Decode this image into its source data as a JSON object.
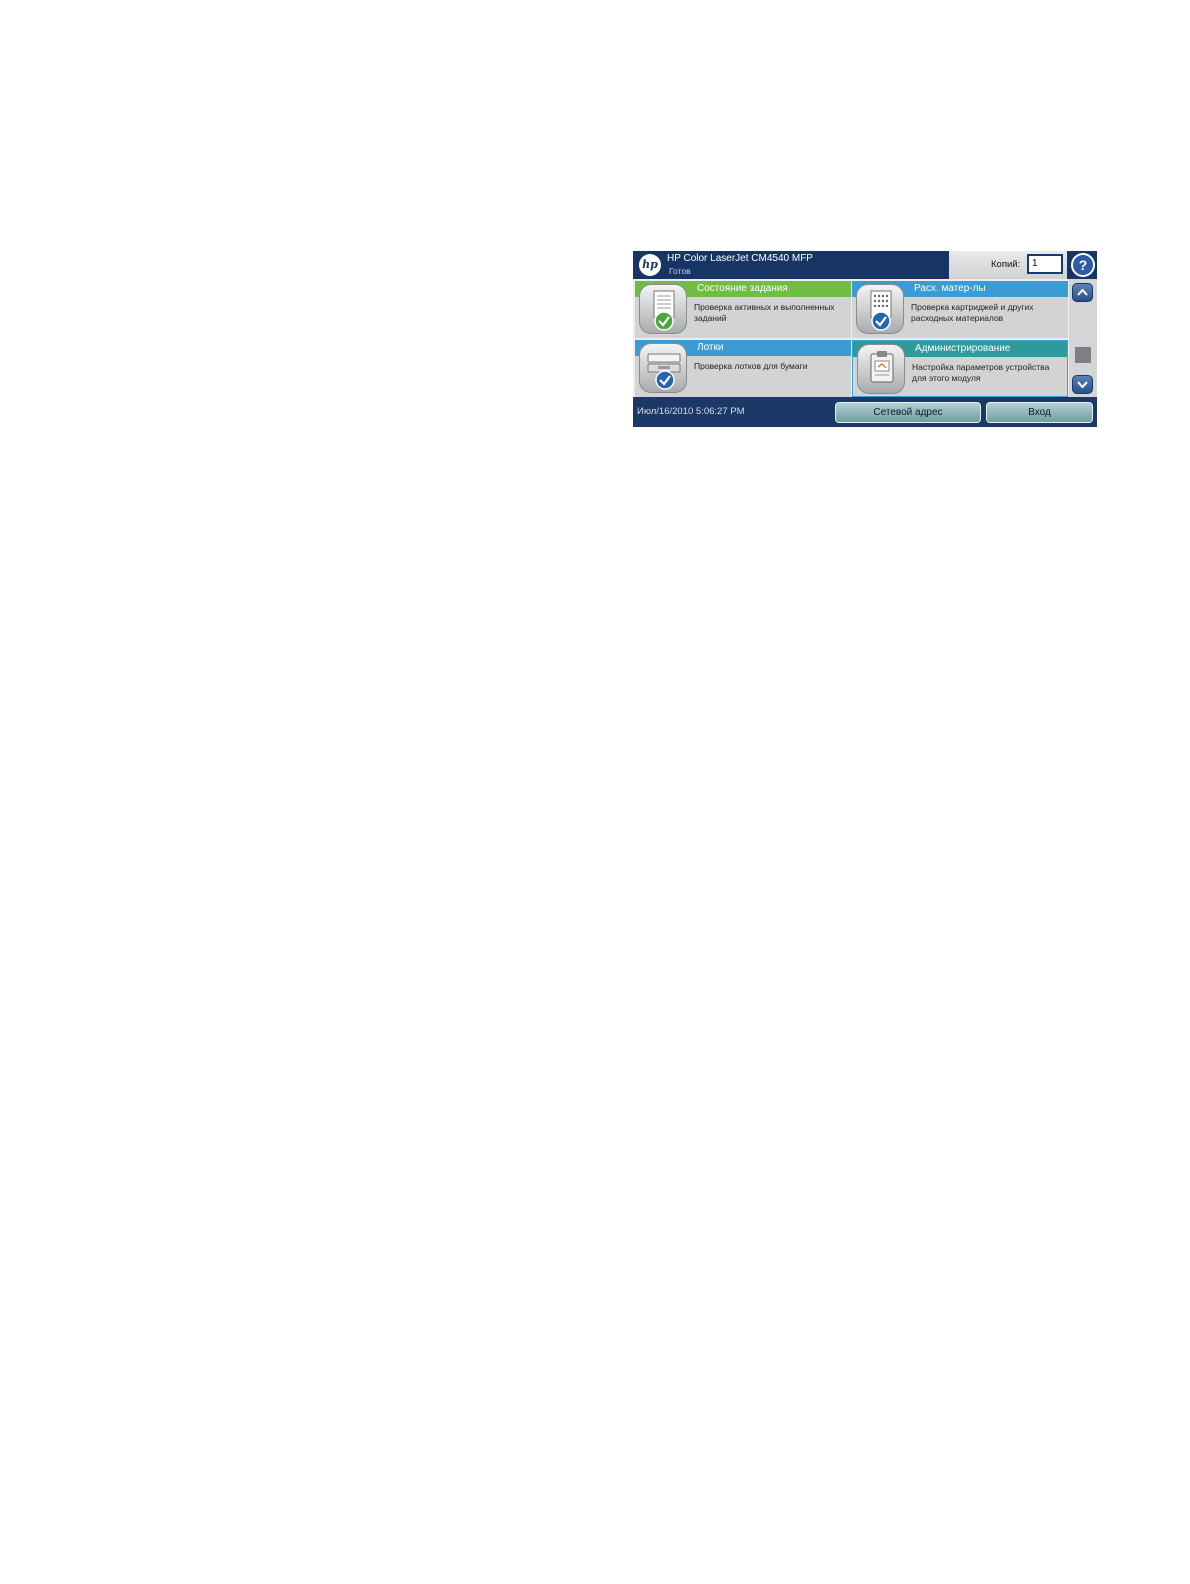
{
  "header": {
    "logo_text": "hp",
    "title": "HP Color LaserJet CM4540 MFP",
    "status": "Готов"
  },
  "copies": {
    "label": "Копий:",
    "value": "1"
  },
  "help": {
    "symbol": "?"
  },
  "tiles": [
    {
      "title": "Состояние задания",
      "description": "Проверка активных и выполненных заданий",
      "color": "#6fbd45",
      "icon": "job-status-icon"
    },
    {
      "title": "Расх. матер-лы",
      "description": "Проверка картриджей и других расходных материалов",
      "color": "#3a9bd5",
      "icon": "supplies-icon"
    },
    {
      "title": "Лотки",
      "description": "Проверка лотков для бумаги",
      "color": "#3a9bd5",
      "icon": "trays-icon"
    },
    {
      "title": "Администрирование",
      "description": "Настройка параметров устройства для этого модуля",
      "color": "#2e9a9c",
      "icon": "administration-icon"
    }
  ],
  "footer": {
    "datetime": "Июл/16/2010 5:06:27 PM",
    "network_button": "Сетевой адрес",
    "login_button": "Вход"
  },
  "colors": {
    "header_bg": "#163565",
    "footer_bg": "#1a3966",
    "tile_bg": "#d3d3d3",
    "button_teal": "#8fb7b9"
  }
}
